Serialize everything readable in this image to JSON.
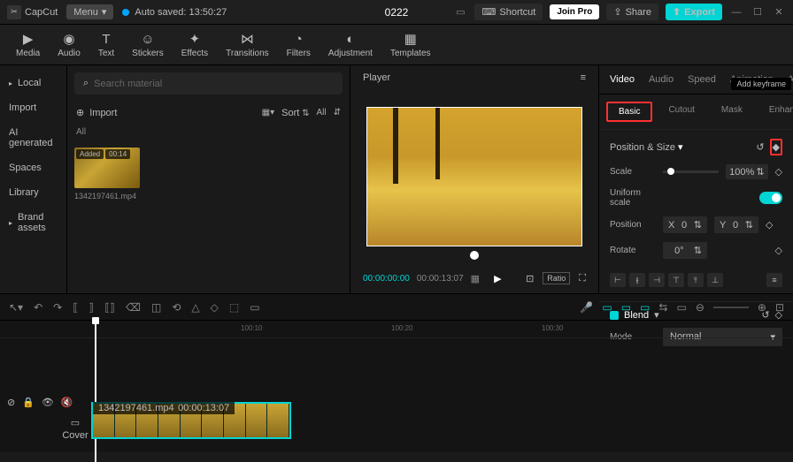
{
  "top": {
    "app": "CapCut",
    "menu": "Menu",
    "autosave": "Auto saved: 13:50:27",
    "title": "0222",
    "shortcut": "Shortcut",
    "joinpro": "Join Pro",
    "share": "Share",
    "export": "Export"
  },
  "tools": [
    "Media",
    "Audio",
    "Text",
    "Stickers",
    "Effects",
    "Transitions",
    "Filters",
    "Adjustment",
    "Templates"
  ],
  "sidebar": {
    "items": [
      "Local",
      "Import",
      "AI generated",
      "Spaces",
      "Library",
      "Brand assets"
    ]
  },
  "media": {
    "search_ph": "Search material",
    "import": "Import",
    "sort": "Sort",
    "all": "All",
    "alltab": "All",
    "added": "Added",
    "duration": "00:14",
    "clipname": "1342197461.mp4"
  },
  "player": {
    "title": "Player",
    "tc1": "00:00:00:00",
    "tc2": "00:00:13:07",
    "ratio": "Ratio"
  },
  "rtabs": [
    "Video",
    "Audio",
    "Speed",
    "Animation",
    "Adjust"
  ],
  "subtabs": [
    "Basic",
    "Cutout",
    "Mask",
    "Enhance"
  ],
  "props": {
    "section": "Position & Size",
    "tooltip": "Add keyframe",
    "scale": "Scale",
    "scaleval": "100%",
    "uniform": "Uniform scale",
    "position": "Position",
    "x": "X",
    "xval": "0",
    "y": "Y",
    "yval": "0",
    "rotate": "Rotate",
    "rotval": "0°",
    "blend": "Blend",
    "mode": "Mode",
    "modeval": "Normal"
  },
  "timeline": {
    "t1": "100:10",
    "t2": "100:20",
    "t3": "100:30",
    "cover": "Cover",
    "trackname": "1342197461.mp4",
    "trackdur": "00:00:13:07"
  }
}
